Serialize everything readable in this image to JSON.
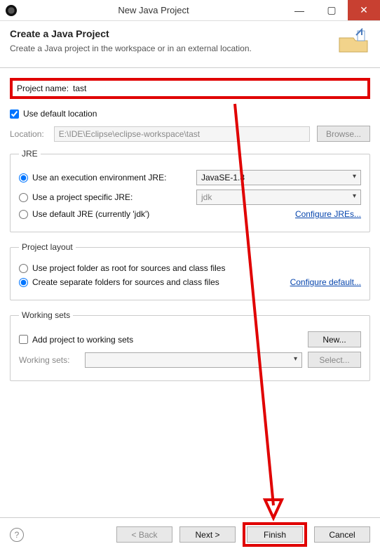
{
  "window": {
    "title": "New Java Project"
  },
  "header": {
    "title": "Create a Java Project",
    "subtitle": "Create a Java project in the workspace or in an external location."
  },
  "projectName": {
    "label": "Project name:",
    "value": "tast"
  },
  "defaultLocation": {
    "label": "Use default location",
    "checked": true
  },
  "location": {
    "label": "Location:",
    "value": "E:\\IDE\\Eclipse\\eclipse-workspace\\tast",
    "browse": "Browse..."
  },
  "jre": {
    "legend": "JRE",
    "options": {
      "exec_env": {
        "label": "Use an execution environment JRE:",
        "selected": true,
        "select_value": "JavaSE-1.8"
      },
      "project_specific": {
        "label": "Use a project specific JRE:",
        "selected": false,
        "select_value": "jdk"
      },
      "default": {
        "label": "Use default JRE (currently 'jdk')",
        "selected": false
      }
    },
    "configure_link": "Configure JREs..."
  },
  "project_layout": {
    "legend": "Project layout",
    "options": {
      "root": {
        "label": "Use project folder as root for sources and class files",
        "selected": false
      },
      "separate": {
        "label": "Create separate folders for sources and class files",
        "selected": true
      }
    },
    "configure_link": "Configure default..."
  },
  "working_sets": {
    "legend": "Working sets",
    "add": {
      "label": "Add project to working sets",
      "checked": false
    },
    "new_btn": "New...",
    "ws_label": "Working sets:",
    "ws_value": "",
    "select_btn": "Select..."
  },
  "footer": {
    "back": "< Back",
    "next": "Next >",
    "finish": "Finish",
    "cancel": "Cancel"
  }
}
